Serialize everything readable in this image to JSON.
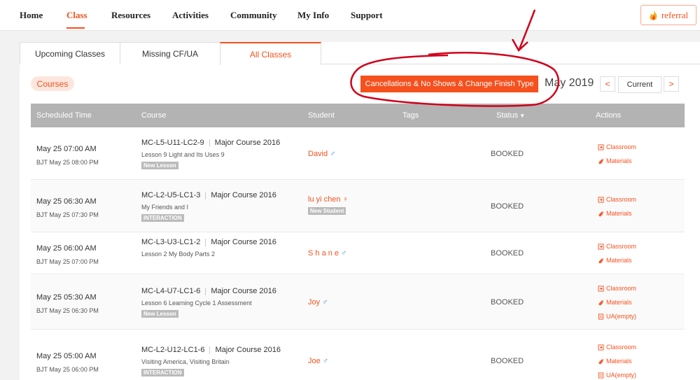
{
  "nav": {
    "items": [
      "Home",
      "Class",
      "Resources",
      "Activities",
      "Community",
      "My Info",
      "Support"
    ],
    "referral": "referral"
  },
  "tabs": [
    "Upcoming Classes",
    "Missing CF/UA",
    "All Classes"
  ],
  "toolbar": {
    "courses": "Courses",
    "cancellations": "Cancellations & No Shows & Change Finish Type",
    "month": "May 2019",
    "prev": "<",
    "current": "Current",
    "next": ">"
  },
  "table": {
    "headers": [
      "Scheduled Time",
      "Course",
      "Student",
      "Tags",
      "Status",
      "Actions"
    ],
    "rows": [
      {
        "time": "May 25 07:00 AM",
        "bjt": "BJT May 25 08:00 PM",
        "code": "MC-L5-U11-LC2-9",
        "course": "Major Course 2016",
        "lesson": "Lesson 9 Light and Its Uses 9",
        "tag": "New Lesson",
        "student": "David",
        "gender": "♂",
        "student_tag": "",
        "status": "BOOKED",
        "actions": [
          "Classroom",
          "Materials"
        ]
      },
      {
        "time": "May 25 06:30 AM",
        "bjt": "BJT May 25 07:30 PM",
        "code": "MC-L2-U5-LC1-3",
        "course": "Major Course 2016",
        "lesson": "My Friends and I",
        "tag": "INTERACTION",
        "student": "lu yi chen",
        "gender": "♀",
        "student_tag": "New Student",
        "status": "BOOKED",
        "actions": [
          "Classroom",
          "Materials"
        ]
      },
      {
        "time": "May 25 06:00 AM",
        "bjt": "BJT May 25 07:00 PM",
        "code": "MC-L3-U3-LC1-2",
        "course": "Major Course 2016",
        "lesson": "Lesson 2 My Body Parts 2",
        "tag": "",
        "student": "S h a n e",
        "gender": "♂",
        "student_tag": "",
        "status": "BOOKED",
        "actions": [
          "Classroom",
          "Materials"
        ]
      },
      {
        "time": "May 25 05:30 AM",
        "bjt": "BJT May 25 06:30 PM",
        "code": "MC-L4-U7-LC1-6",
        "course": "Major Course 2016",
        "lesson": "Lesson 6 Learning Cycle 1 Assessment",
        "tag": "New Lesson",
        "student": "Joy",
        "gender": "♂",
        "student_tag": "",
        "status": "BOOKED",
        "actions": [
          "Classroom",
          "Materials",
          "UA(empty)"
        ]
      },
      {
        "time": "May 25 05:00 AM",
        "bjt": "BJT May 25 06:00 PM",
        "code": "MC-L2-U12-LC1-6",
        "course": "Major Course 2016",
        "lesson": "Visiting America, Visiting Britain",
        "tag": "INTERACTION",
        "student": "Joe",
        "gender": "♂",
        "student_tag": "",
        "status": "BOOKED",
        "actions": [
          "Classroom",
          "Materials",
          "UA(empty)"
        ]
      }
    ]
  },
  "colors": {
    "accent": "#f4511e",
    "header_bg": "#b3b3b3",
    "male": "#3a8fd8",
    "annotation": "#d0021b"
  }
}
